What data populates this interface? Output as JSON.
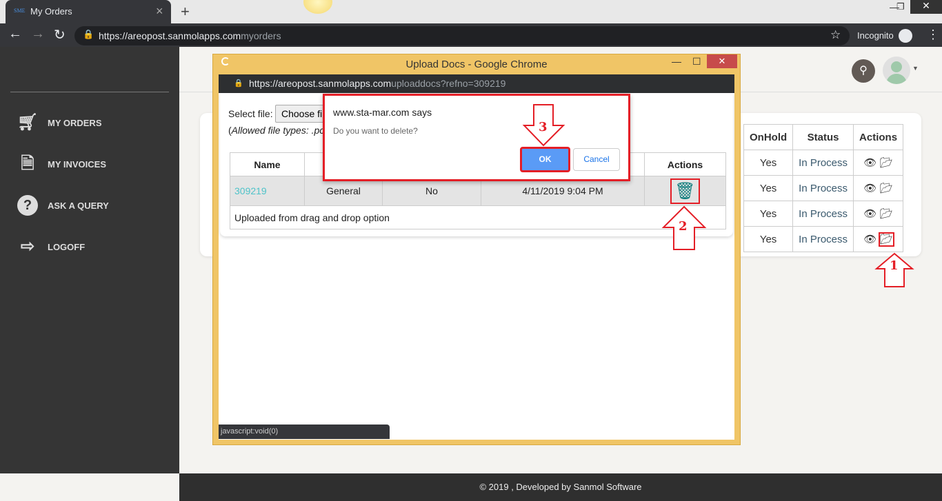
{
  "browser": {
    "tab_title": "My Orders",
    "favicon_text": "SME",
    "url_host": "https://areopost.sanmolapps.com",
    "url_path": "myorders",
    "incognito_label": "Incognito"
  },
  "sidebar": {
    "items": [
      {
        "label": "MY ORDERS",
        "icon": "cart-icon"
      },
      {
        "label": "MY INVOICES",
        "icon": "invoice-icon"
      },
      {
        "label": "ASK A QUERY",
        "icon": "question-icon"
      },
      {
        "label": "LOGOFF",
        "icon": "logoff-icon"
      }
    ]
  },
  "orders": {
    "headers": [
      "OnHold",
      "Status",
      "Actions"
    ],
    "rows": [
      {
        "onhold": "Yes",
        "status": "In Process"
      },
      {
        "onhold": "Yes",
        "status": "In Process"
      },
      {
        "onhold": "Yes",
        "status": "In Process"
      },
      {
        "onhold": "Yes",
        "status": "In Process"
      }
    ]
  },
  "popup": {
    "title": "Upload Docs - Google Chrome",
    "url_host": "https://areopost.sanmolapps.com",
    "url_path": "uploaddocs?refno=309219",
    "select_label": "Select file:",
    "choose_button": "Choose fi",
    "allowed_text": "Allowed file types: .pc",
    "table": {
      "headers": [
        "Name",
        "",
        "",
        "",
        "Actions"
      ],
      "row": [
        "309219",
        "General",
        "No",
        "4/11/2019 9:04 PM"
      ],
      "note": "Uploaded from drag and drop option"
    },
    "status_bar": "javascript:void(0)"
  },
  "alert": {
    "title": "www.sta-mar.com says",
    "message": "Do you want to delete?",
    "ok": "OK",
    "cancel": "Cancel"
  },
  "annotations": [
    "1",
    "2",
    "3"
  ],
  "footer": "© 2019 , Developed by Sanmol Software",
  "colors": {
    "annotation": "#e41e26",
    "link": "#4fc3c9",
    "ok_button": "#5a9bf6",
    "trash": "#0f7d7d"
  }
}
